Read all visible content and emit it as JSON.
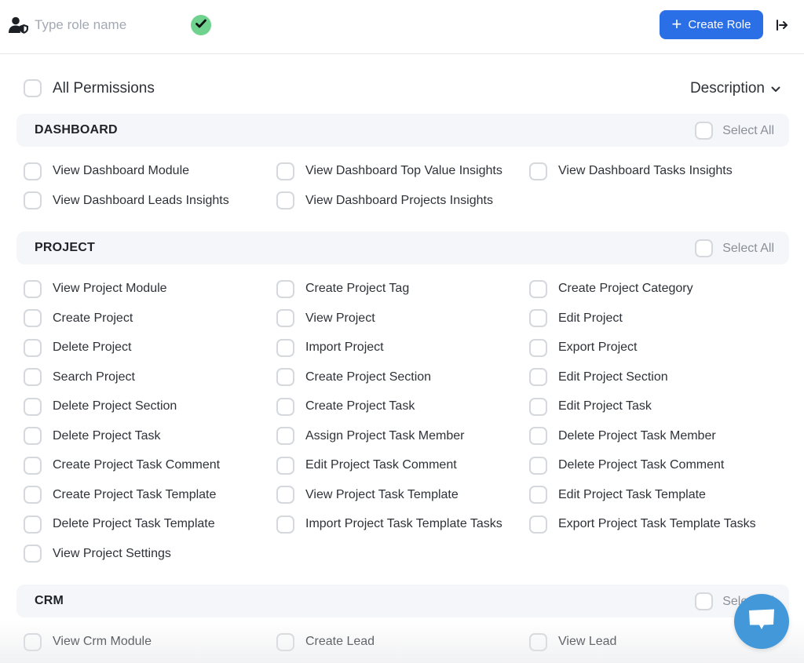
{
  "header": {
    "role_input_placeholder": "Type role name",
    "role_input_value": "",
    "create_role_label": "Create Role",
    "icons": {
      "role": "user-shield-icon",
      "confirm": "check-circle-icon",
      "create": "plus-icon",
      "exit": "logout-arrow-icon"
    },
    "colors": {
      "primary": "#2b6fe6",
      "confirm": "#6fd38f",
      "chat": "#4298d8"
    }
  },
  "toolbar": {
    "all_permissions_label": "All Permissions",
    "all_permissions_checked": false,
    "description_label": "Description"
  },
  "sections": [
    {
      "title": "DASHBOARD",
      "select_all_label": "Select All",
      "permissions": [
        "View Dashboard Module",
        "View Dashboard Top Value Insights",
        "View Dashboard Tasks Insights",
        "View Dashboard Leads Insights",
        "View Dashboard Projects Insights"
      ]
    },
    {
      "title": "PROJECT",
      "select_all_label": "Select All",
      "permissions": [
        "View Project Module",
        "Create Project Tag",
        "Create Project Category",
        "Create Project",
        "View Project",
        "Edit Project",
        "Delete Project",
        "Import Project",
        "Export Project",
        "Search Project",
        "Create Project Section",
        "Edit Project Section",
        "Delete Project Section",
        "Create Project Task",
        "Edit Project Task",
        "Delete Project Task",
        "Assign Project Task Member",
        "Delete Project Task Member",
        "Create Project Task Comment",
        "Edit Project Task Comment",
        "Delete Project Task Comment",
        "Create Project Task Template",
        "View Project Task Template",
        "Edit Project Task Template",
        "Delete Project Task Template",
        "Import Project Task Template Tasks",
        "Export Project Task Template Tasks",
        "View Project Settings"
      ]
    },
    {
      "title": "CRM",
      "select_all_label": "Select All",
      "permissions": [
        "View Crm Module",
        "Create Lead",
        "View Lead"
      ]
    }
  ],
  "chat": {
    "icon": "chat-bubble-icon"
  }
}
